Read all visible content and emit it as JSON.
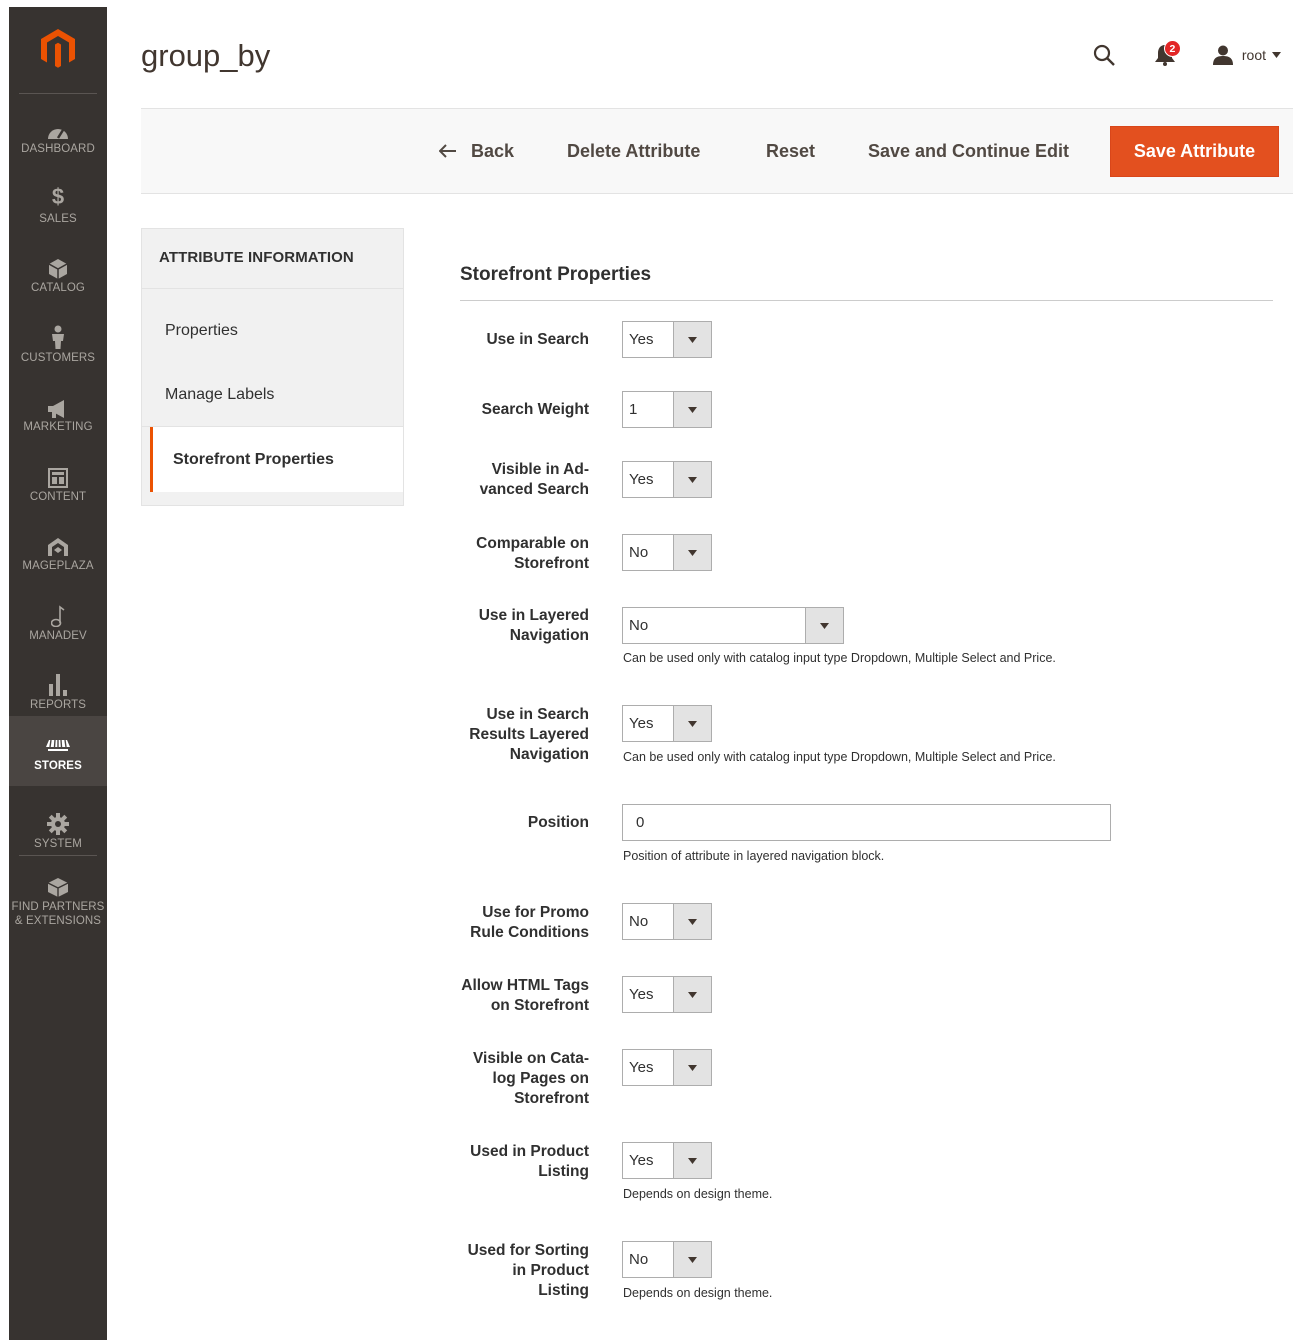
{
  "nav": {
    "items": [
      {
        "key": "dashboard",
        "label": "DASHBOARD",
        "icon": "dashboard-icon"
      },
      {
        "key": "sales",
        "label": "SALES",
        "icon": "dollar-icon"
      },
      {
        "key": "catalog",
        "label": "CATALOG",
        "icon": "cube-icon"
      },
      {
        "key": "customers",
        "label": "CUSTOMERS",
        "icon": "person-icon"
      },
      {
        "key": "marketing",
        "label": "MARKETING",
        "icon": "megaphone-icon"
      },
      {
        "key": "content",
        "label": "CONTENT",
        "icon": "layout-icon"
      },
      {
        "key": "mageplaza",
        "label": "MAGEPLAZA",
        "icon": "mageplaza-icon"
      },
      {
        "key": "manadev",
        "label": "MANADEV",
        "icon": "note-icon"
      },
      {
        "key": "reports",
        "label": "REPORTS",
        "icon": "bar-chart-icon"
      },
      {
        "key": "stores",
        "label": "STORES",
        "icon": "store-icon",
        "active": true
      },
      {
        "key": "system",
        "label": "SYSTEM",
        "icon": "gear-icon"
      }
    ],
    "partners": {
      "line1": "FIND PARTNERS",
      "line2": "& EXTENSIONS",
      "icon": "blocks-icon"
    }
  },
  "header": {
    "title": "group_by",
    "notifications_count": "2",
    "user_name": "root"
  },
  "actions": {
    "back": "Back",
    "delete": "Delete Attribute",
    "reset": "Reset",
    "save_continue": "Save and Continue Edit",
    "save": "Save Attribute"
  },
  "tabs": {
    "title": "ATTRIBUTE INFORMATION",
    "items": [
      "Properties",
      "Manage Labels",
      "Storefront Properties"
    ],
    "active": "Storefront Properties"
  },
  "section": {
    "title": "Storefront Properties"
  },
  "fields": {
    "use_in_search": {
      "label": "Use in Search",
      "value": "Yes"
    },
    "search_weight": {
      "label": "Search Weight",
      "value": "1"
    },
    "visible_adv_search": {
      "label1": "Visible in Ad-",
      "label2": "vanced Search",
      "value": "Yes"
    },
    "comparable": {
      "label1": "Comparable on",
      "label2": "Storefront",
      "value": "No"
    },
    "layered_nav": {
      "label1": "Use in Layered",
      "label2": "Navigation",
      "value": "No",
      "note": "Can be used only with catalog input type Dropdown, Multiple Select and Price."
    },
    "search_layered_nav": {
      "label1": "Use in Search",
      "label2": "Results Layered",
      "label3": "Navigation",
      "value": "Yes",
      "note": "Can be used only with catalog input type Dropdown, Multiple Select and Price."
    },
    "position": {
      "label": "Position",
      "value": "0",
      "note": "Position of attribute in layered navigation block."
    },
    "promo_rules": {
      "label1": "Use for Promo",
      "label2": "Rule Conditions",
      "value": "No"
    },
    "html_tags": {
      "label1": "Allow HTML Tags",
      "label2": "on Storefront",
      "value": "Yes"
    },
    "visible_catalog": {
      "label1": "Visible on Cata-",
      "label2": "log Pages on",
      "label3": "Storefront",
      "value": "Yes"
    },
    "product_listing": {
      "label1": "Used in Product",
      "label2": "Listing",
      "value": "Yes",
      "note": "Depends on design theme."
    },
    "sorting": {
      "label1": "Used for Sorting",
      "label2": "in Product",
      "label3": "Listing",
      "value": "No",
      "note": "Depends on design theme."
    }
  },
  "colors": {
    "nav_bg": "#373330",
    "accent": "#eb5202",
    "save_button": "#e3501f",
    "badge": "#e22626"
  }
}
